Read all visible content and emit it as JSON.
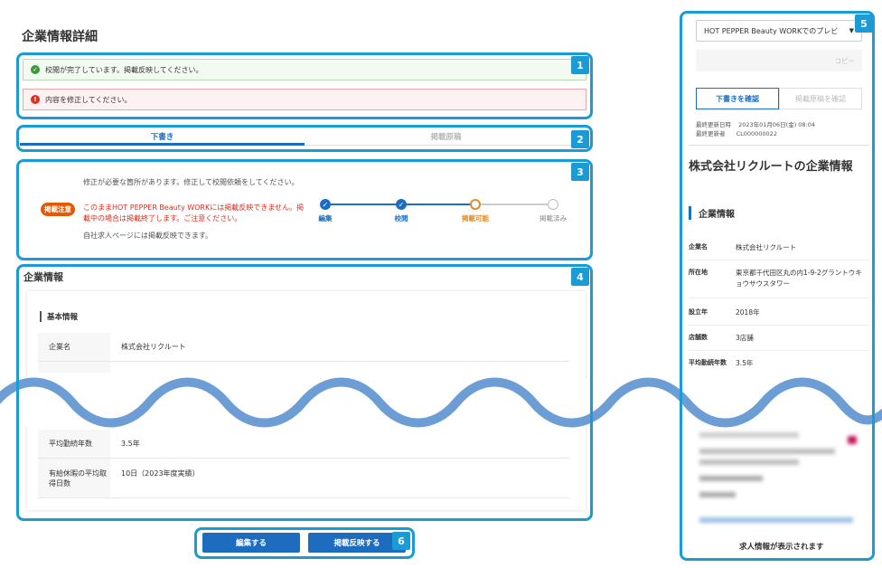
{
  "page": {
    "title": "企業情報詳細"
  },
  "callout_numbers": [
    "1",
    "2",
    "3",
    "4",
    "5",
    "6"
  ],
  "alerts": {
    "success": "校閲が完了しています。掲載反映してください。",
    "error": "内容を修正してください。"
  },
  "tabs": [
    {
      "label": "下書き"
    },
    {
      "label": "掲載原稿"
    }
  ],
  "status": {
    "badge": "掲載注意",
    "line1": "修正が必要な箇所があります。修正して校閲依頼をしてください。",
    "warn1": "このままHOT PEPPER Beauty WORKには掲載反映できません。掲載中の場合は掲載終了します。ご注意ください。",
    "line3": "自社求人ページには掲載反映できます。",
    "steps": [
      "編集",
      "校閲",
      "掲載可能",
      "掲載済み"
    ]
  },
  "company": {
    "section_title": "企業情報",
    "subheading": "基本情報",
    "rows": [
      {
        "key": "企業名",
        "value": "株式会社リクルート"
      },
      {
        "key": "平均勤続年数",
        "value": "3.5年"
      },
      {
        "key": "有給休暇の平均取得日数",
        "value": "10日（2023年度実績）"
      }
    ]
  },
  "actions": {
    "edit": "編集する",
    "publish": "掲載反映する"
  },
  "preview": {
    "select_value": "HOT PEPPER Beauty WORKでのプレビ",
    "copy_label": "コピー",
    "btn_draft": "下書きを確認",
    "btn_published": "掲載原稿を確認",
    "updated_label": "最終更新日時",
    "updated_value": "2023年01月06日(金) 08:04",
    "updater_label": "最終更新者",
    "updater_value": "CL000000022",
    "company_title": "株式会社リクルートの企業情報",
    "section": "企業情報",
    "rows": [
      {
        "key": "企業名",
        "value": "株式会社リクルート"
      },
      {
        "key": "所在地",
        "value": "東京都千代田区丸の内1-9-2グラントウキョウサウスタワー"
      },
      {
        "key": "設立年",
        "value": "2018年"
      },
      {
        "key": "店舗数",
        "value": "3店舗"
      },
      {
        "key": "平均勤続年数",
        "value": "3.5年"
      }
    ],
    "job_message": "求人情報が表示されます"
  },
  "colors": {
    "accent": "#1d6cc0",
    "callout": "#1a9bd6",
    "warn": "#d9301f",
    "badge": "#e25a00"
  }
}
